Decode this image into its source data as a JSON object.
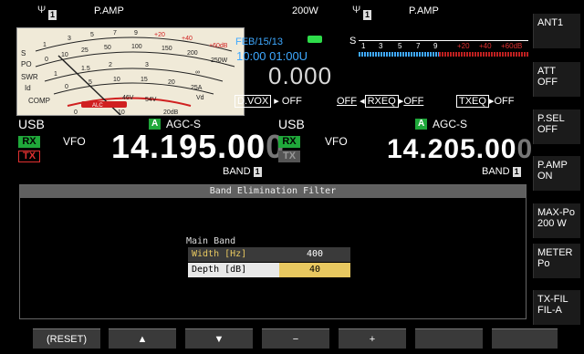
{
  "top": {
    "ant_left_num": "1",
    "pamp_left": "P.AMP",
    "power": "200W",
    "ant_right_num": "1",
    "pamp_right": "P.AMP"
  },
  "meter": {
    "s_label": "S",
    "po_label": "PO",
    "swr_label": "SWR",
    "id_label": "Id",
    "comp_label": "COMP",
    "s_scale": [
      "1",
      "3",
      "5",
      "7",
      "9",
      "+20",
      "+40",
      "+60dB"
    ],
    "po_scale": [
      "0",
      "10",
      "25",
      "50",
      "100",
      "150",
      "200",
      "250W"
    ],
    "swr_scale": [
      "1",
      "1.5",
      "2",
      "3",
      "∞"
    ],
    "id_scale": [
      "0",
      "5",
      "10",
      "15",
      "20",
      "25A"
    ],
    "vd_scale": [
      "46V",
      "54V",
      "Vd"
    ],
    "alc_label": "ALC",
    "comp_scale": [
      "0",
      "10",
      "20dB"
    ]
  },
  "clock": {
    "date": "FEB/15/13",
    "time": "10:00 01:00U",
    "readout": "0.000"
  },
  "flags": {
    "dvox": "D.VOX",
    "dvox_state": "OFF",
    "rxeq_prefix": "OFF",
    "rxeq": "RXEQ",
    "rxeq_state": "OFF",
    "txeq": "TXEQ",
    "txeq_state": "OFF"
  },
  "sub_meter": {
    "s_label": "S",
    "scale": [
      "1",
      "3",
      "5",
      "7",
      "9"
    ],
    "scale_red": [
      "+20",
      "+40",
      "+60dB"
    ]
  },
  "main_vfo": {
    "mode": "USB",
    "agc_badge": "A",
    "agc": "AGC-S",
    "rx": "RX",
    "tx": "TX",
    "vfo": "VFO",
    "freq": "14.195.00",
    "freq_last": "0",
    "band": "BAND",
    "band_num": "1"
  },
  "sub_vfo": {
    "mode": "USB",
    "agc_badge": "A",
    "agc": "AGC-S",
    "rx": "RX",
    "tx": "TX",
    "vfo": "VFO",
    "freq": "14.205.00",
    "freq_last": "0",
    "band": "BAND",
    "band_num": "1"
  },
  "function_keys": [
    {
      "line1": "ANT1",
      "line2": ""
    },
    {
      "line1": "ATT",
      "line2": "OFF"
    },
    {
      "line1": "P.SEL",
      "line2": "OFF"
    },
    {
      "line1": "P.AMP",
      "line2": "ON"
    },
    {
      "line1": "MAX-Po",
      "line2": "200 W"
    },
    {
      "line1": "METER",
      "line2": "Po"
    },
    {
      "line1": "TX-FIL",
      "line2": "FIL-A"
    }
  ],
  "dialog": {
    "title": "Band Elimination Filter",
    "section": "Main Band",
    "rows": [
      {
        "label": "Width [Hz]",
        "value": "400"
      },
      {
        "label": "Depth [dB]",
        "value": "40"
      }
    ]
  },
  "soft_keys": {
    "reset": "(RESET)",
    "up": "▲",
    "down": "▼",
    "minus": "−",
    "plus": "+",
    "blank1": "",
    "blank2": ""
  },
  "colors": {
    "accent_green": "#1fa83a",
    "accent_blue": "#3fa9ff",
    "tx_red": "#e03030",
    "highlight_yellow": "#e8c860"
  }
}
